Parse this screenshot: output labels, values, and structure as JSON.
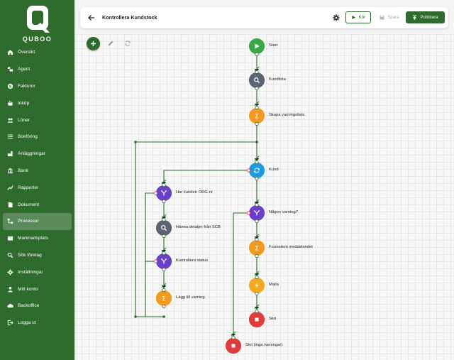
{
  "app": {
    "logo_text": "QUBOO"
  },
  "sidebar": {
    "items": [
      {
        "label": "Översikt",
        "icon": "home-icon",
        "active": false
      },
      {
        "label": "Agent",
        "icon": "agent-icon",
        "active": false
      },
      {
        "label": "Fakturor",
        "icon": "dollar-icon",
        "active": false
      },
      {
        "label": "Inköp",
        "icon": "basket-icon",
        "active": false
      },
      {
        "label": "Löner",
        "icon": "people-icon",
        "active": false
      },
      {
        "label": "Bokföring",
        "icon": "list-icon",
        "active": false
      },
      {
        "label": "Anläggningar",
        "icon": "factory-icon",
        "active": false
      },
      {
        "label": "Bank",
        "icon": "bank-icon",
        "active": false
      },
      {
        "label": "Rapporter",
        "icon": "chart-icon",
        "active": false
      },
      {
        "label": "Dokument",
        "icon": "document-icon",
        "active": false
      },
      {
        "label": "Processer",
        "icon": "process-icon",
        "active": true
      },
      {
        "label": "Marknadsplats",
        "icon": "market-icon",
        "active": false
      },
      {
        "label": "Sök företag",
        "icon": "search-icon",
        "active": false
      },
      {
        "label": "Inställningar",
        "icon": "gear-icon",
        "active": false
      },
      {
        "label": "Mitt konto",
        "icon": "person-icon",
        "active": false
      },
      {
        "label": "Backoffice",
        "icon": "cloud-icon",
        "active": false
      },
      {
        "label": "Logga ut",
        "icon": "logout-icon",
        "active": false
      }
    ]
  },
  "header": {
    "title": "Kontrollera Kundstock",
    "run_label": "Kör",
    "save_label": "Spara",
    "publish_label": "Publicera"
  },
  "colors": {
    "brand": "#2e6b2c",
    "start": "#3aa845",
    "search": "#5a6473",
    "sum": "#f39a1e",
    "loop": "#1e9be0",
    "branch": "#6b3fc9",
    "mail": "#f3a81e",
    "end": "#e23b3b"
  },
  "flow": {
    "nodes": [
      {
        "id": "start",
        "label": "Start",
        "kind": "start"
      },
      {
        "id": "kundlista",
        "label": "Kundlista",
        "kind": "search"
      },
      {
        "id": "skapa",
        "label": "Skapa varningslista",
        "kind": "sum"
      },
      {
        "id": "kund",
        "label": "Kund",
        "kind": "loop"
      },
      {
        "id": "orgnr",
        "label": "Har kunden ORG-nr",
        "kind": "branch"
      },
      {
        "id": "scb",
        "label": "Hämta detaljer från SCB",
        "kind": "search"
      },
      {
        "id": "status",
        "label": "Kontrollera status",
        "kind": "branch"
      },
      {
        "id": "lagg",
        "label": "Lägg till varning",
        "kind": "sum"
      },
      {
        "id": "varning",
        "label": "Någon varning?",
        "kind": "branch"
      },
      {
        "id": "formatera",
        "label": "Formatera meddelandet",
        "kind": "sum"
      },
      {
        "id": "maila",
        "label": "Maila",
        "kind": "mail"
      },
      {
        "id": "slut",
        "label": "Slut",
        "kind": "end"
      },
      {
        "id": "slut2",
        "label": "Slut (inga varningar)",
        "kind": "end"
      }
    ]
  }
}
